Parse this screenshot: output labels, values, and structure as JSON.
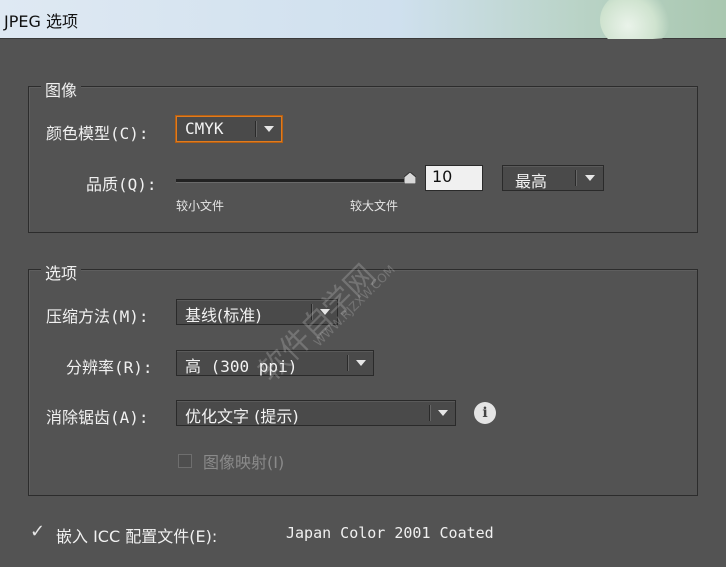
{
  "window": {
    "title": "JPEG 选项"
  },
  "image_group": {
    "legend": "图像",
    "color_model": {
      "label": "颜色模型(C):",
      "value": "CMYK"
    },
    "quality": {
      "label": "品质(Q):",
      "value": "10",
      "level": 1.0,
      "preset": "最高",
      "min_label": "较小文件",
      "max_label": "较大文件"
    }
  },
  "options_group": {
    "legend": "选项",
    "compression": {
      "label": "压缩方法(M):",
      "value": "基线(标准)"
    },
    "resolution": {
      "label": "分辨率(R):",
      "value": "高 (300 ppi)"
    },
    "antialias": {
      "label": "消除锯齿(A):",
      "value": "优化文字 (提示)"
    },
    "image_map": {
      "label": "图像映射(I)",
      "checked": false,
      "enabled": false
    }
  },
  "icc": {
    "checked": true,
    "label": "嵌入 ICC 配置文件(E):",
    "profile": "Japan Color 2001 Coated"
  },
  "watermark": {
    "text": "软件自学网",
    "url": "WWW.RJZXW.COM"
  }
}
